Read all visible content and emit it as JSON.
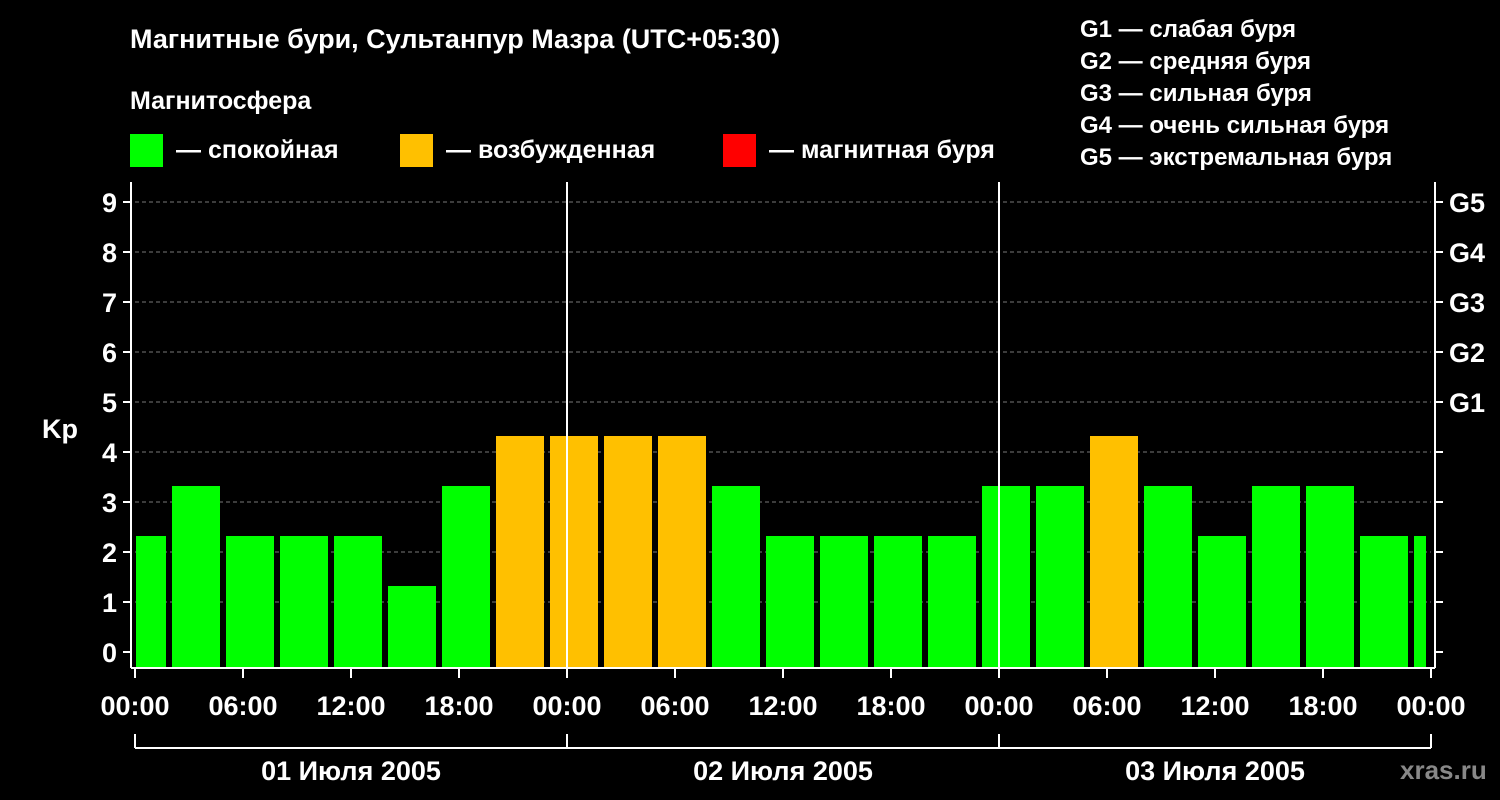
{
  "chart_data": {
    "type": "bar",
    "title": "Магнитные бури, Сультанпур Мазра (UTC+05:30)",
    "legend_title": "Магнитосфера",
    "legend": [
      {
        "label": "— спокойная",
        "color": "#00ff00"
      },
      {
        "label": "— возбужденная",
        "color": "#ffc000"
      },
      {
        "label": "— магнитная буря",
        "color": "#ff0000"
      }
    ],
    "g_scale": [
      "G1 — слабая буря",
      "G2 — средняя буря",
      "G3 — сильная буря",
      "G4 — очень сильная буря",
      "G5 — экстремальная буря"
    ],
    "ylabel": "Kp",
    "ylim": [
      0,
      9
    ],
    "yticks": [
      "0",
      "1",
      "2",
      "3",
      "4",
      "5",
      "6",
      "7",
      "8",
      "9"
    ],
    "right_ticks": [
      {
        "value": 5,
        "label": "G1"
      },
      {
        "value": 6,
        "label": "G2"
      },
      {
        "value": 7,
        "label": "G3"
      },
      {
        "value": 8,
        "label": "G4"
      },
      {
        "value": 9,
        "label": "G5"
      }
    ],
    "x_hours_total": 72,
    "x_tick_labels": [
      "00:00",
      "06:00",
      "12:00",
      "18:00",
      "00:00",
      "06:00",
      "12:00",
      "18:00",
      "00:00",
      "06:00",
      "12:00",
      "18:00",
      "00:00"
    ],
    "dates": [
      "01 Июля 2005",
      "02 Июля 2005",
      "03 Июля 2005"
    ],
    "bar_start_hours": [
      0,
      2,
      5,
      8,
      11,
      14,
      17,
      20,
      23,
      26,
      29,
      32,
      35,
      38,
      41,
      44,
      47,
      50,
      53,
      56,
      59,
      62,
      65,
      68,
      71
    ],
    "values": [
      2,
      3,
      2,
      2,
      2,
      1,
      3,
      4,
      4,
      4,
      4,
      3,
      2,
      2,
      2,
      2,
      3,
      3,
      4,
      3,
      2,
      3,
      3,
      2,
      2
    ],
    "colors": {
      "quiet": "#00ff00",
      "unsettled": "#ffc000",
      "storm": "#ff0000"
    },
    "grid": true,
    "watermark": "xras.ru"
  }
}
